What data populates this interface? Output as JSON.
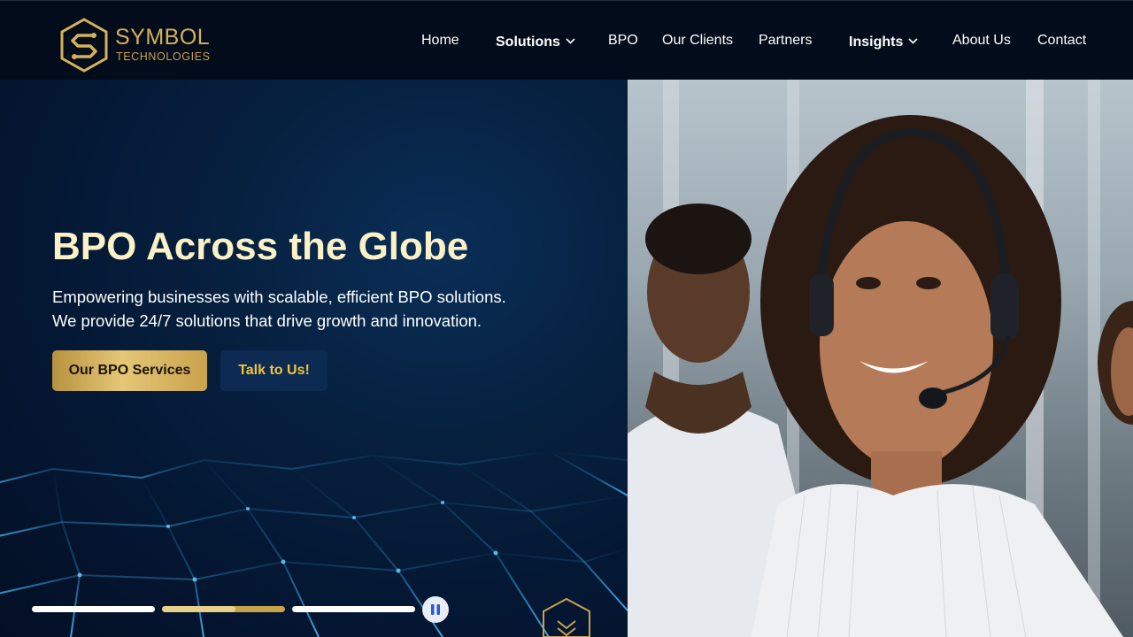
{
  "brand": {
    "name": "SYMBOL",
    "tagline": "TECHNOLOGIES",
    "gold": "#d5b15a"
  },
  "nav": {
    "home": "Home",
    "solutions": "Solutions",
    "bpo": "BPO",
    "clients": "Our Clients",
    "partners": "Partners",
    "insights": "Insights",
    "about": "About Us",
    "contact": "Contact"
  },
  "hero": {
    "title": "BPO Across the Globe",
    "subtitle_line1": "Empowering businesses with scalable, efficient BPO solutions.",
    "subtitle_line2": "We provide 24/7 solutions that drive growth and innovation.",
    "primary_button": "Our BPO Services",
    "secondary_button": "Talk to Us!",
    "image_alt": "call-center-agents-with-headsets"
  },
  "slider": {
    "slides": 3,
    "active_index": 1,
    "active_progress": 0.6,
    "pause_icon": "pause-icon",
    "scroll_icon": "chevron-double-down-icon"
  }
}
